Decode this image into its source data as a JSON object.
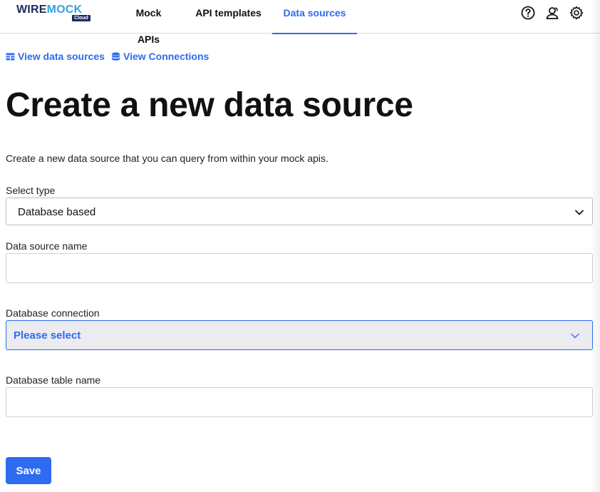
{
  "header": {
    "logo": {
      "word1": "WIRE",
      "word2": "MOCK",
      "badge": "Cloud"
    },
    "tabs": [
      {
        "label": "Mock APIs",
        "active": false
      },
      {
        "label": "API templates",
        "active": false
      },
      {
        "label": "Data sources",
        "active": true
      }
    ],
    "icons": [
      "help-icon",
      "users-icon",
      "gear-icon"
    ]
  },
  "links": {
    "view_data_sources": "View data sources",
    "view_connections": "View Connections"
  },
  "page": {
    "title": "Create a new data source",
    "description": "Create a new data source that you can query from within your mock apis."
  },
  "form": {
    "select_type": {
      "label": "Select type",
      "value": "Database based"
    },
    "data_source_name": {
      "label": "Data source name",
      "value": ""
    },
    "database_connection": {
      "label": "Database connection",
      "value": "Please select"
    },
    "database_table_name": {
      "label": "Database table name",
      "value": ""
    },
    "save_label": "Save"
  },
  "colors": {
    "accent": "#2d6bf0",
    "logo_dark": "#1a2a5c",
    "logo_light": "#3aa0e0",
    "focused_select_bg": "#ebebf0"
  }
}
